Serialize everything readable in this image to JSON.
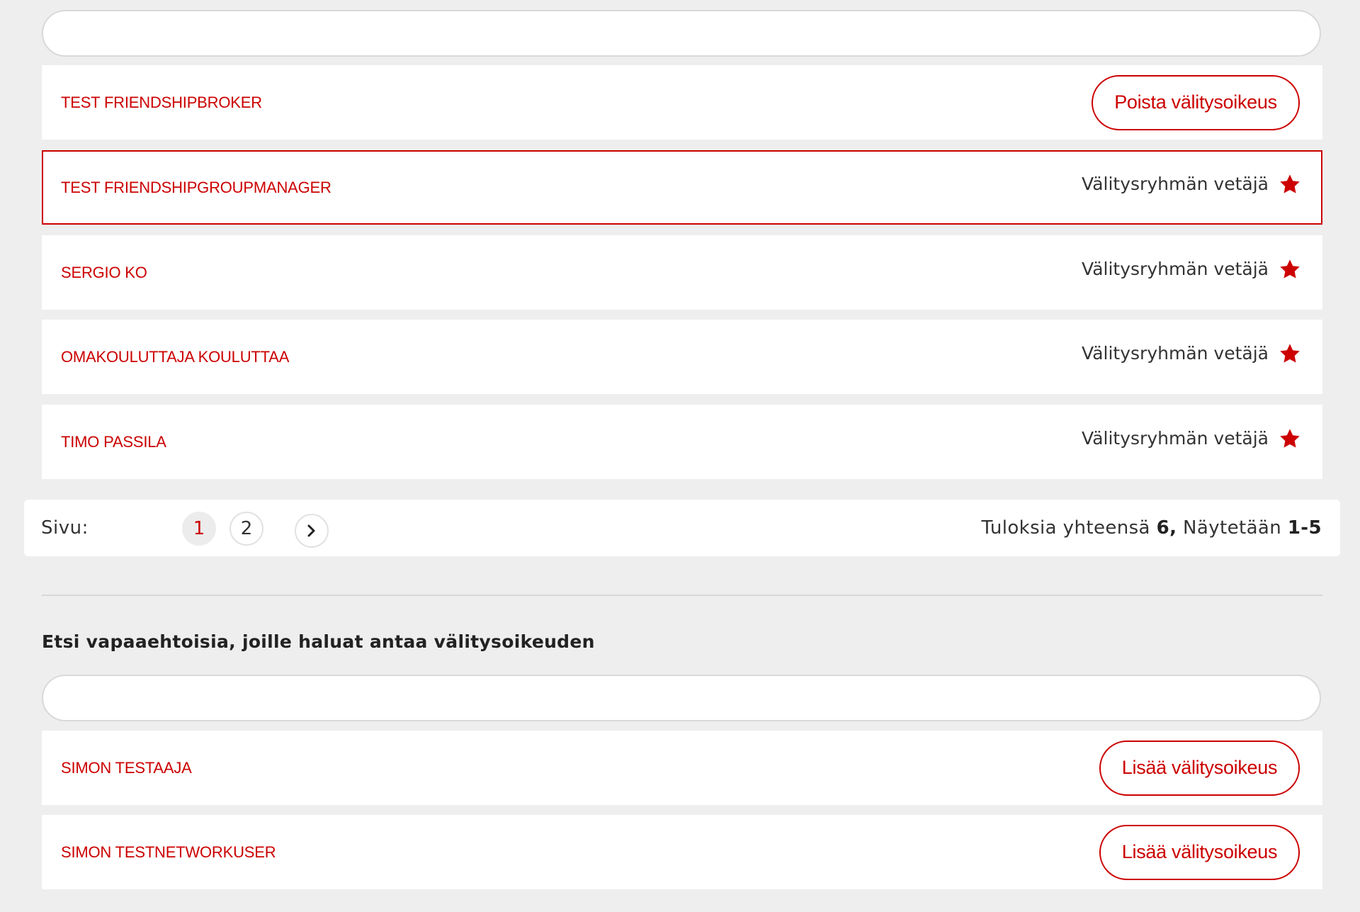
{
  "brokers": {
    "search": {
      "value": "",
      "placeholder": ""
    },
    "rows": [
      {
        "name": "TEST FRIENDSHIPBROKER",
        "action_label": "Poista välitysoikeus"
      },
      {
        "name": "TEST FRIENDSHIPGROUPMANAGER",
        "role": "Välitysryhmän vetäjä",
        "role_icon": "star-icon"
      },
      {
        "name": "SERGIO KO",
        "role": "Välitysryhmän vetäjä",
        "role_icon": "star-icon"
      },
      {
        "name": "OMAKOULUTTAJA KOULUTTAA",
        "role": "Välitysryhmän vetäjä",
        "role_icon": "star-icon"
      },
      {
        "name": "TIMO PASSILA",
        "role": "Välitysryhmän vetäjä",
        "role_icon": "star-icon"
      }
    ],
    "pagination": {
      "label": "Sivu:",
      "pages": [
        "1",
        "2"
      ],
      "current": "1",
      "next_icon": "chevron-right-icon",
      "summary_prefix": "Tuloksia yhteensä",
      "total": "6,",
      "showing_label": "Näytetään",
      "showing_range": "1-5"
    }
  },
  "volunteers": {
    "title": "Etsi vapaaehtoisia, joille haluat antaa välitysoikeuden",
    "search": {
      "value": "",
      "placeholder": ""
    },
    "rows": [
      {
        "name": "SIMON TESTAAJA",
        "action_label": "Lisää välitysoikeus"
      },
      {
        "name": "SIMON TESTNETWORKUSER",
        "action_label": "Lisää välitysoikeus"
      }
    ]
  },
  "colors": {
    "accent": "#cc0000",
    "background": "#eeeeee",
    "card": "#ffffff",
    "text": "#333333"
  }
}
